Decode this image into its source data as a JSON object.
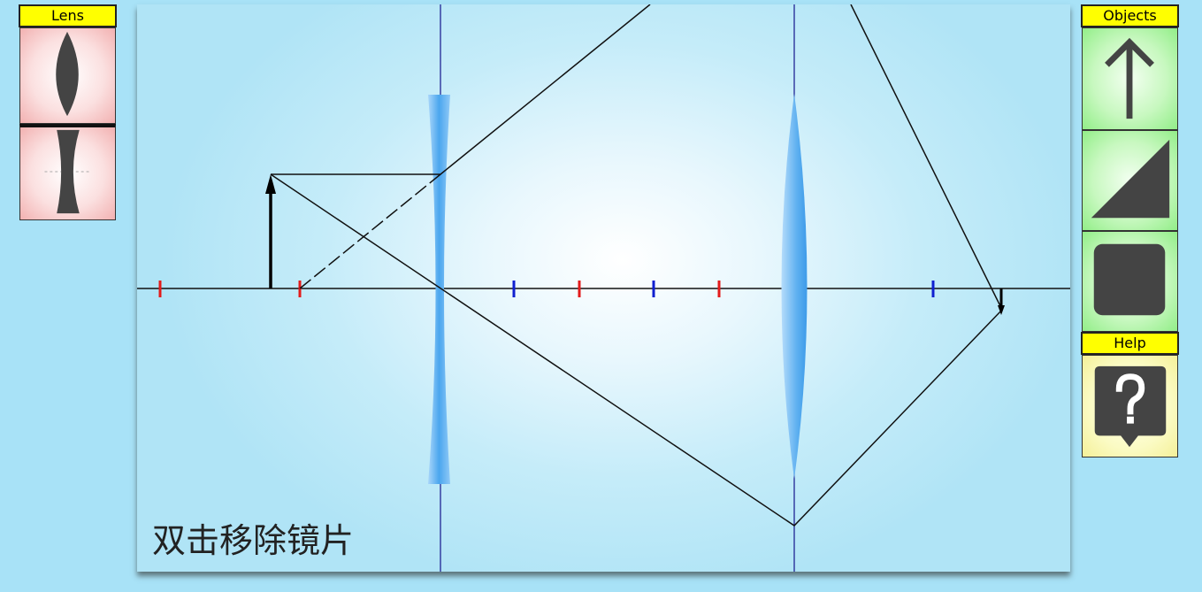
{
  "panels": {
    "lens": {
      "title": "Lens",
      "items": [
        {
          "icon": "convex-lens-icon"
        },
        {
          "icon": "concave-lens-icon"
        }
      ]
    },
    "objects": {
      "title": "Objects",
      "items": [
        {
          "icon": "arrow-up-icon"
        },
        {
          "icon": "triangle-icon"
        },
        {
          "icon": "square-icon"
        }
      ]
    },
    "help": {
      "title": "Help",
      "items": [
        {
          "icon": "question-bubble-icon"
        }
      ]
    }
  },
  "canvas": {
    "hint": "双击移除镜片"
  },
  "colors": {
    "background": "#a8e2f7",
    "title_bar": "#ffff00",
    "lens_fill": "#4aa6ee",
    "focal_red": "#e31b1b",
    "focal_blue": "#1020d0",
    "lens_axis": "#14148c"
  }
}
